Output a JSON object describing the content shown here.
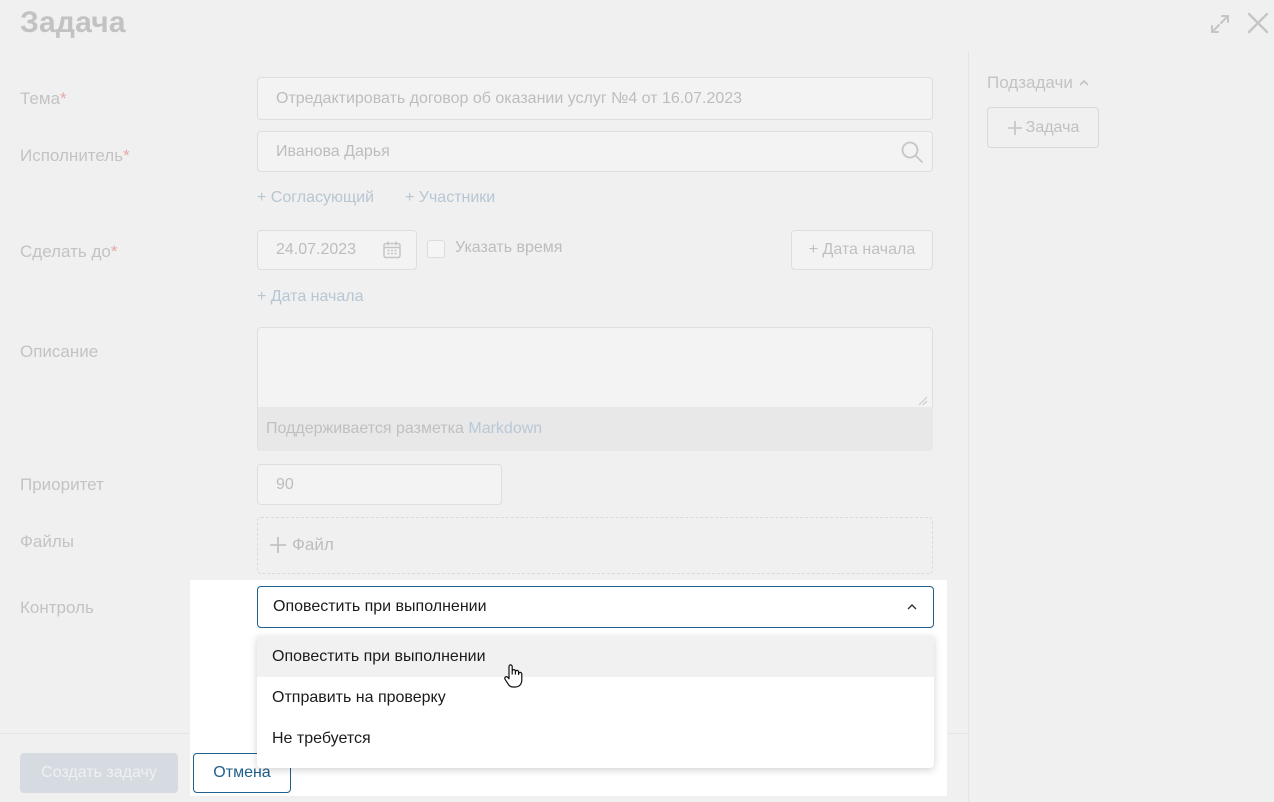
{
  "header": {
    "title": "Задача",
    "expand_icon": "expand-icon",
    "close_icon": "close-icon"
  },
  "form": {
    "topic": {
      "label": "Тема",
      "required_mark": "*",
      "value": "Отредактировать договор об оказании услуг №4 от 16.07.2023"
    },
    "assignee": {
      "label": "Исполнитель",
      "required_mark": "*",
      "value": "Иванова Дарья",
      "icon": "search-icon"
    },
    "extra_links": {
      "approver": "+ Согласующий",
      "participants": "+ Участники"
    },
    "due": {
      "label": "Сделать до",
      "required_mark": "*",
      "value": "24.07.2023",
      "icon": "calendar-icon",
      "time_checkbox_label": "Указать время",
      "start_date_button": "+ Дата начала",
      "start_date_link": "+ Дата начала"
    },
    "description": {
      "label": "Описание",
      "hint_prefix": "Поддерживается разметка",
      "hint_link": "Markdown"
    },
    "priority": {
      "label": "Приоритет",
      "value": "90"
    },
    "files": {
      "label": "Файлы",
      "add_file": "Файл"
    },
    "control": {
      "label": "Контроль",
      "selected": "Оповестить при выполнении",
      "options": [
        "Оповестить при выполнении",
        "Отправить на проверку",
        "Не требуется"
      ],
      "hovered_index": 0
    }
  },
  "sidebar": {
    "subtasks_label": "Подзадачи",
    "add_task": "Задача"
  },
  "footer": {
    "create_button": "Создать задачу",
    "cancel_button": "Отмена"
  },
  "colors": {
    "accent": "#1f5f8b",
    "disabled_button": "#d5dbe1",
    "muted_text": "#c3c3c3",
    "required": "#e4a9a9"
  }
}
